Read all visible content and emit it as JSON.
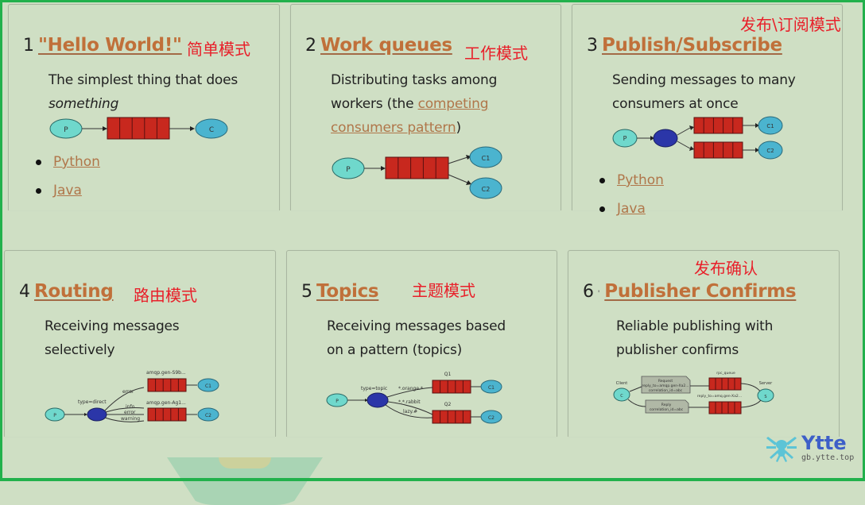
{
  "cards": [
    {
      "number": "1",
      "title": "\"Hello World!\"",
      "cn_label": "简单模式",
      "desc_line1": "The simplest thing that does",
      "desc_line2": "something",
      "links": [
        "Python",
        "Java"
      ],
      "diagram": {
        "producer": "P",
        "consumers": [
          "C"
        ]
      }
    },
    {
      "number": "2",
      "title": "Work queues",
      "cn_label": "工作模式",
      "desc_line1": "Distributing tasks among",
      "desc_line2_prefix": "workers (the ",
      "desc_link1": "competing",
      "desc_link2": "consumers pattern",
      "desc_suffix": ")",
      "diagram": {
        "producer": "P",
        "consumers": [
          "C1",
          "C2"
        ]
      }
    },
    {
      "number": "3",
      "title": "Publish/Subscribe",
      "cn_label": "发布\\订阅模式",
      "desc_line1": "Sending messages to many",
      "desc_line2": "consumers at once",
      "links": [
        "Python",
        "Java"
      ],
      "diagram": {
        "producer": "P",
        "exchange": "X",
        "consumers": [
          "C1",
          "C2"
        ]
      }
    },
    {
      "number": "4",
      "title": "Routing",
      "cn_label": "路由模式",
      "desc_line1": "Receiving messages",
      "desc_line2": "selectively",
      "diagram": {
        "producer": "P",
        "exchange": "X",
        "exchange_type": "type=direct",
        "queues": [
          "amqp.gen-S9b...",
          "amqp.gen-Ag1..."
        ],
        "bindings": [
          "error",
          "info",
          "error",
          "warning"
        ],
        "consumers": [
          "C1",
          "C2"
        ]
      }
    },
    {
      "number": "5",
      "title": "Topics",
      "cn_label": "主题模式",
      "desc_line1": "Receiving messages based",
      "desc_line2": "on a pattern (topics)",
      "diagram": {
        "producer": "P",
        "exchange": "X",
        "exchange_type": "type=topic",
        "queues": [
          "Q1",
          "Q2"
        ],
        "bindings": [
          "*.orange.*",
          "*.*.rabbit",
          "lazy.#"
        ],
        "consumers": [
          "C1",
          "C2"
        ]
      }
    },
    {
      "number": "6",
      "title": "Publisher Confirms",
      "cn_label": "发布确认",
      "desc_line1": "Reliable publishing with",
      "desc_line2": "publisher confirms",
      "diagram": {
        "client": "Client",
        "client_node": "C",
        "server": "Server",
        "server_node": "S",
        "request_line1": "Request",
        "request_line2": "reply_to=amqp.gen-Xa2...",
        "request_line3": "correlation_id=abc",
        "reply_line1": "Reply",
        "reply_line2": "correlation_id=abc",
        "rpc_queue": "rpc_queue",
        "reply_queue": "reply_to=amq.gen-Xa2..."
      }
    }
  ],
  "watermark": {
    "name": "Ytte",
    "url": "gb.ytte.top"
  },
  "colors": {
    "frame": "#22b14c",
    "background": "#cfdfc4",
    "link": "#c0703a",
    "annotation": "#e8202a",
    "queue": "#c8281e"
  }
}
